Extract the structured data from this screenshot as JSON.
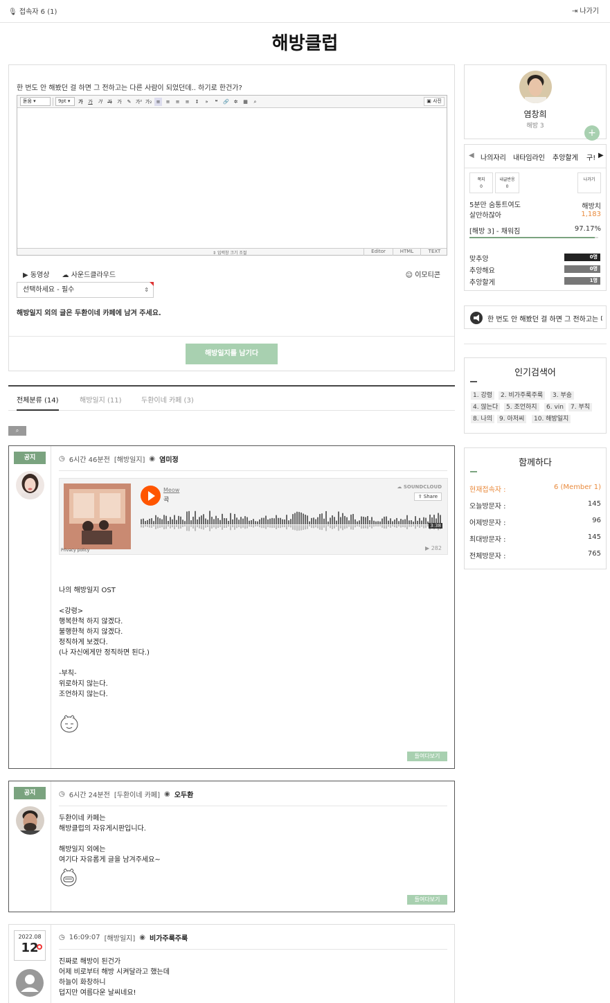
{
  "topbar": {
    "users": "접속자 6 (1)",
    "exit": "나가기"
  },
  "site_title": "해방클럽",
  "write": {
    "notice": "한 번도 안 해봤던 걸 하면 그 전하고는 다른 사람이 되었던데.. 하기로 한건가?",
    "toolbar": {
      "font": "돋움",
      "size": "9pt",
      "photo": "사진"
    },
    "editor_resize": "입력창 크기 조절",
    "modes": [
      "Editor",
      "HTML",
      "TEXT"
    ],
    "video": "동영상",
    "soundcloud": "사운드클라우드",
    "emoticon": "이모티콘",
    "select": "선택하세요 - 필수",
    "help": "해방일지 외의 글은 두환이네 카페에 남겨 주세요.",
    "submit": "해방일지를 남기다"
  },
  "tabs": [
    {
      "label": "전체분류 (14)"
    },
    {
      "label": "해방일지 (11)"
    },
    {
      "label": "두환이네 카페 (3)"
    }
  ],
  "posts": [
    {
      "badge": "공지",
      "time": "6시간 46분전",
      "category": "[해방일지]",
      "author": "염미정",
      "soundcloud": {
        "user": "Meow",
        "track": "곡",
        "brand": "SOUNDCLOUD",
        "share": "Share",
        "duration": "3:38",
        "privacy": "Privacy policy",
        "plays": "282"
      },
      "body": "나의 해방일지 OST\n\n<강령>\n행복한척 하지 않겠다.\n불행한척 하지 않겠다.\n정직하게 보겠다.\n(나 자신에게만 정직하면 된다.)\n\n-부칙-\n위로하지 않는다.\n조언하지 않는다.",
      "more": "들여다보기"
    },
    {
      "badge": "공지",
      "time": "6시간 24분전",
      "category": "[두환이네 카페]",
      "author": "오두환",
      "body": "두환이네 카페는\n해방클럽의 자유게시판입니다.\n\n해방일지 외에는\n여기다 자유롭게 글을 남겨주세요~",
      "more": "들여다보기"
    },
    {
      "date_ym": "2022.08",
      "date_d": "12",
      "time": "16:09:07",
      "category": "[해방일지]",
      "author": "비가주룩주룩",
      "body": "진짜로 해방이 된건가\n어제 비로부터 해방 시켜달라고 했는데\n하늘이 화창하니\n덥지만 여름다운 날씨네요!"
    }
  ],
  "profile": {
    "name": "염창희",
    "level": "해방 3"
  },
  "side_menu": [
    "나의자리",
    "내타임라인",
    "추앙할게",
    "구!"
  ],
  "side_buttons": {
    "note": "쪽지",
    "note_count": "0",
    "react": "내글반응",
    "react_count": "0",
    "exit": "나가기"
  },
  "side_stats": {
    "status": "5분만 숨통트여도\n살만하잖아",
    "point_label": "해방치",
    "point_value": "1,183",
    "level_label": "[해방 3] - 채워짐",
    "level_percent": "97.17%",
    "level_fraction": 0.9717,
    "rows": [
      {
        "label": "맞추앙",
        "value": "0명",
        "color": "#222222"
      },
      {
        "label": "추앙해요",
        "value": "0명",
        "color": "#777777"
      },
      {
        "label": "추앙할게",
        "value": "1명",
        "color": "#777777"
      }
    ]
  },
  "side_notice": "한 번도 안 해봤던 걸 하면 그 전하고는 다른 사람이 되었던데..",
  "popular": {
    "title": "인기검색어",
    "keywords": [
      "1. 강령",
      "2. 비가주룩주룩",
      "3. 부숑",
      "4. 않는다",
      "5. 조언하지",
      "6. vin",
      "7. 부칙",
      "8. 나의",
      "9. 아저씨",
      "10. 해방일지"
    ]
  },
  "together": {
    "title": "함께하다",
    "rows": [
      {
        "label": "현재접속자 :",
        "value": "6 (Member 1)"
      },
      {
        "label": "오늘방문자 :",
        "value": "145"
      },
      {
        "label": "어제방문자 :",
        "value": "96"
      },
      {
        "label": "최대방문자 :",
        "value": "145"
      },
      {
        "label": "전체방문자 :",
        "value": "765"
      }
    ]
  }
}
